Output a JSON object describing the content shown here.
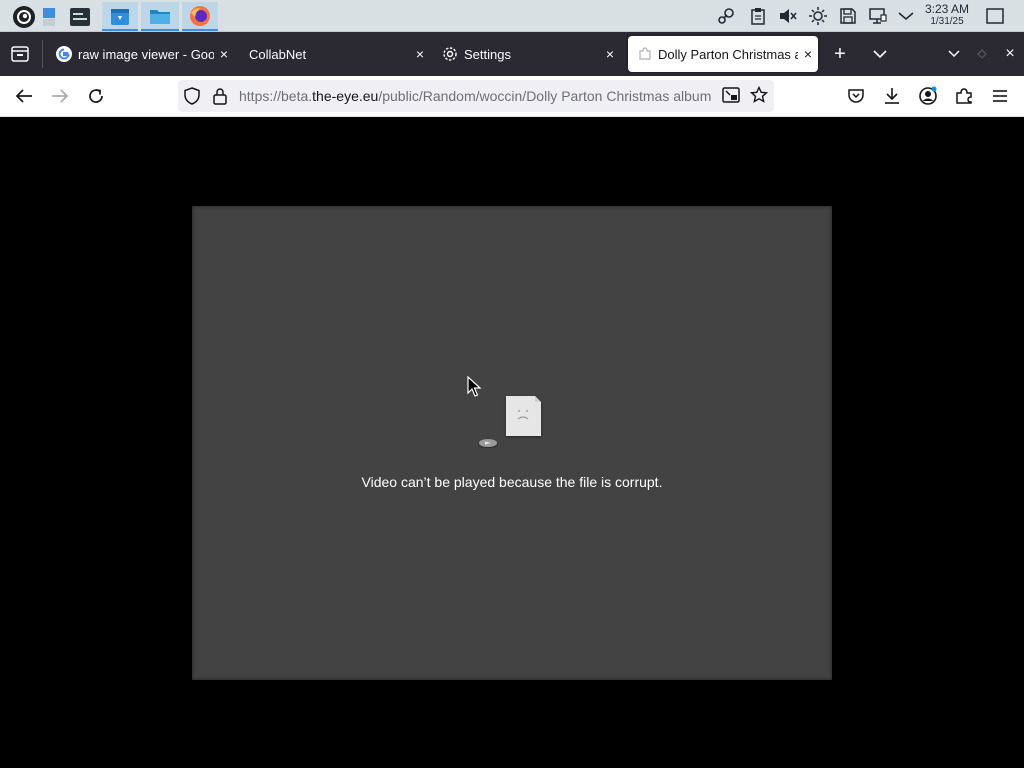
{
  "taskbar": {
    "clock_time": "3:23 AM",
    "clock_date": "1/31/25",
    "apps": [
      "system-menu-icon",
      "pager-icon",
      "system-monitor-icon",
      "discover-store-icon",
      "dolphin-files-icon",
      "firefox-icon"
    ],
    "tray": [
      "steam-icon",
      "clipboard-icon",
      "volume-muted-icon",
      "brightness-icon",
      "storage-icon",
      "network-icon",
      "expand-tray-icon",
      "show-desktop-icon"
    ]
  },
  "tabs": [
    {
      "label": "raw image viewer - Google Search",
      "favicon": "google-icon",
      "close": "×"
    },
    {
      "label": "CollabNet",
      "favicon": "",
      "close": "×"
    },
    {
      "label": "Settings",
      "favicon": "gear-icon",
      "close": "×"
    },
    {
      "label": "Dolly Parton Christmas album",
      "favicon": "puzzle-icon",
      "close": "×",
      "selected": true
    }
  ],
  "tabbar_buttons": {
    "new_tab": "+",
    "list_all": "chevron-down-icon",
    "window_close": "×"
  },
  "url": {
    "prefix": "https://beta.",
    "host": "the-eye.eu",
    "path": "/public/Random/woccin/Dolly Parton Christmas album"
  },
  "video": {
    "error_message": "Video can’t be played because the file is corrupt."
  },
  "colors": {
    "tabbar_bg": "#2b2a33",
    "taskbar_bg": "#d9e0e4",
    "video_bg": "#434343",
    "content_bg": "#000000"
  }
}
